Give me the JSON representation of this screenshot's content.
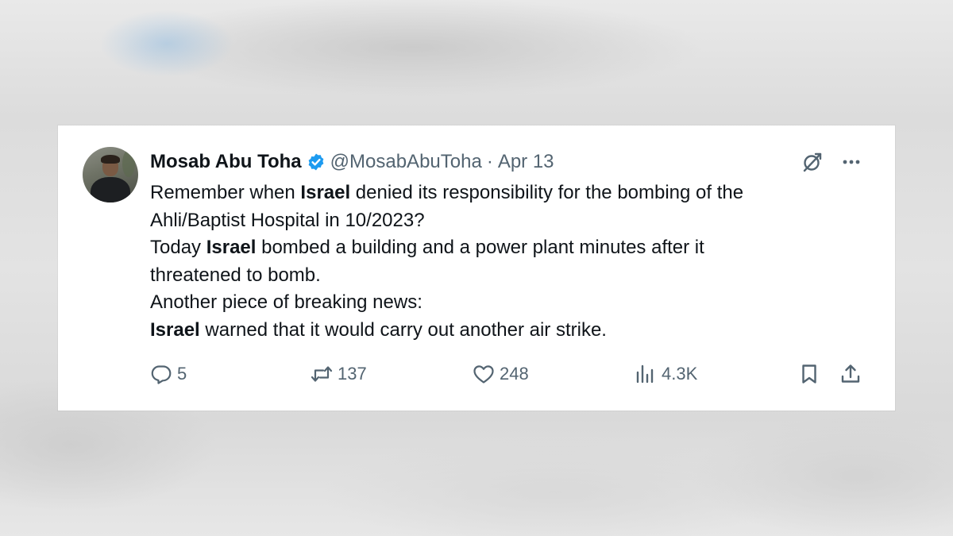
{
  "tweet": {
    "author": {
      "name": "Mosab Abu Toha",
      "handle": "@MosabAbuToha",
      "separator": "·",
      "date": "Apr 13",
      "verified": true,
      "verified_color": "#1d9bf0"
    },
    "lines": [
      {
        "segments": [
          {
            "text": "Remember when ",
            "bold": false
          },
          {
            "text": "Israel",
            "bold": true
          },
          {
            "text": " denied its responsibility for the bombing of the",
            "bold": false
          }
        ]
      },
      {
        "segments": [
          {
            "text": "Ahli/Baptist Hospital in 10/2023?",
            "bold": false
          }
        ]
      },
      {
        "segments": [
          {
            "text": "Today ",
            "bold": false
          },
          {
            "text": "Israel",
            "bold": true
          },
          {
            "text": " bombed a building and a power plant minutes after it",
            "bold": false
          }
        ]
      },
      {
        "segments": [
          {
            "text": "threatened to bomb.",
            "bold": false
          }
        ]
      },
      {
        "segments": [
          {
            "text": "Another piece of breaking news:",
            "bold": false
          }
        ]
      },
      {
        "segments": [
          {
            "text": "Israel",
            "bold": true
          },
          {
            "text": " warned that it would carry out another air strike.",
            "bold": false
          }
        ]
      }
    ],
    "stats": {
      "replies": "5",
      "reposts": "137",
      "likes": "248",
      "views": "4.3K"
    },
    "icons": {
      "grok": "grok-icon",
      "more": "more-icon",
      "reply": "reply-icon",
      "repost": "repost-icon",
      "like": "heart-icon",
      "views": "views-icon",
      "bookmark": "bookmark-icon",
      "share": "share-icon"
    },
    "colors": {
      "text": "#0f1419",
      "secondary": "#536471",
      "card_background": "#ffffff"
    }
  }
}
